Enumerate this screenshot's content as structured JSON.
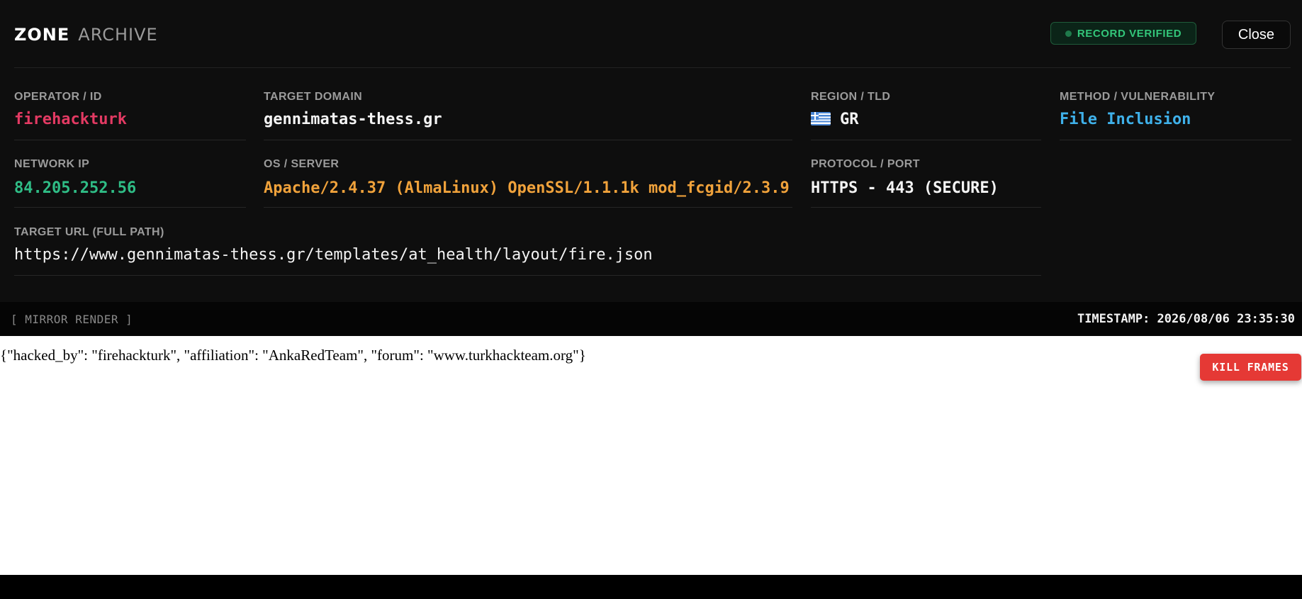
{
  "header": {
    "brand_primary": "ZONE",
    "brand_secondary": "ARCHIVE",
    "verified_label": "RECORD VERIFIED",
    "close_label": "Close"
  },
  "fields": {
    "operator": {
      "label": "OPERATOR / ID",
      "value": "firehackturk"
    },
    "domain": {
      "label": "TARGET DOMAIN",
      "value": "gennimatas-thess.gr"
    },
    "region": {
      "label": "REGION / TLD",
      "value": "GR",
      "flag_icon": "greece-flag-icon"
    },
    "method": {
      "label": "METHOD / VULNERABILITY",
      "value": "File Inclusion"
    },
    "ip": {
      "label": "NETWORK IP",
      "value": "84.205.252.56"
    },
    "server": {
      "label": "OS / SERVER",
      "value": "Apache/2.4.37 (AlmaLinux) OpenSSL/1.1.1k mod_fcgid/2.3.9"
    },
    "protocol": {
      "label": "PROTOCOL / PORT",
      "value": "HTTPS - 443 (SECURE)"
    },
    "url": {
      "label": "TARGET URL (FULL PATH)",
      "value": "https://www.gennimatas-thess.gr/templates/at_health/layout/fire.json"
    }
  },
  "mirror": {
    "label": "[ MIRROR RENDER ]",
    "timestamp": "TIMESTAMP: 2026/08/06 23:35:30"
  },
  "frame": {
    "content": "{\"hacked_by\": \"firehackturk\", \"affiliation\": \"AnkaRedTeam\", \"forum\": \"www.turkhackteam.org\"}",
    "kill_label": "KILL FRAMES"
  },
  "colors": {
    "operator": "#e33a63",
    "method": "#3fb1ea",
    "ip": "#2fbd86",
    "server": "#f0a23b",
    "verified": "#33c67a",
    "kill_button": "#e53935"
  }
}
